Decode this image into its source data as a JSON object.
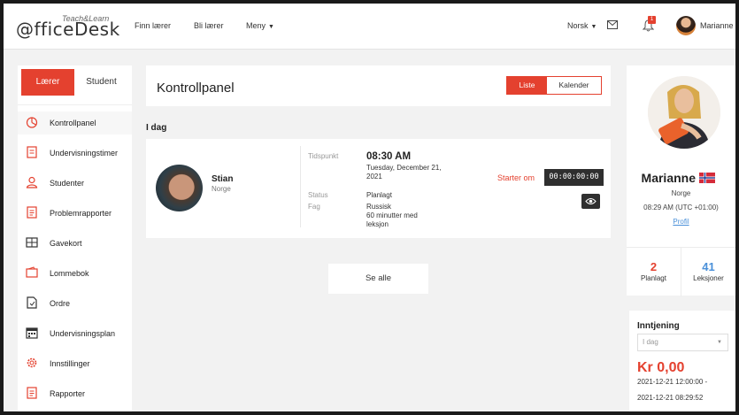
{
  "header": {
    "logo_text": "@fficeDesk",
    "logo_sup": "Teach&Learn",
    "nav": [
      {
        "label": "Finn lærer"
      },
      {
        "label": "Bli lærer"
      },
      {
        "label": "Meny"
      }
    ],
    "language": "Norsk",
    "notification_count": "1",
    "user_name": "Marianne"
  },
  "sidebar": {
    "role_active": "Lærer",
    "role_inactive": "Student",
    "items": [
      {
        "label": "Kontrollpanel",
        "icon": "pie-chart-icon"
      },
      {
        "label": "Undervisningstimer",
        "icon": "document-icon"
      },
      {
        "label": "Studenter",
        "icon": "user-icon"
      },
      {
        "label": "Problemrapporter",
        "icon": "report-icon"
      },
      {
        "label": "Gavekort",
        "icon": "gift-card-icon"
      },
      {
        "label": "Lommebok",
        "icon": "wallet-icon"
      },
      {
        "label": "Ordre",
        "icon": "order-icon"
      },
      {
        "label": "Undervisningsplan",
        "icon": "calendar-icon"
      },
      {
        "label": "Innstillinger",
        "icon": "gear-icon"
      },
      {
        "label": "Rapporter",
        "icon": "report-icon"
      }
    ]
  },
  "main": {
    "title": "Kontrollpanel",
    "view_active": "Liste",
    "view_inactive": "Kalender",
    "today_label": "I dag",
    "lesson": {
      "student_name": "Stian",
      "student_country": "Norge",
      "time_label": "Tidspunkt",
      "time_value": "08:30 AM",
      "date_value": "Tuesday, December 21, 2021",
      "status_label": "Status",
      "status_value": "Planlagt",
      "subject_label": "Fag",
      "subject_value": "Russisk",
      "duration_value": "60 minutter med leksjon",
      "starts_label": "Starter om",
      "countdown": "00:00:00:00"
    },
    "see_all": "Se alle"
  },
  "profile": {
    "name": "Marianne",
    "country": "Norge",
    "local_time": "08:29 AM (UTC +01:00)",
    "link": "Profil"
  },
  "stats": {
    "planned_count": "2",
    "planned_label": "Planlagt",
    "lessons_count": "41",
    "lessons_label": "Leksjoner"
  },
  "earnings": {
    "title": "Inntjening",
    "period": "I dag",
    "amount": "Kr 0,00",
    "range_start": "2021-12-21 12:00:00 -",
    "range_end": "2021-12-21 08:29:52"
  },
  "colors": {
    "accent": "#e4412f",
    "link": "#4a90d9",
    "dark_button": "#2f2f2f",
    "planned": "#e4412f",
    "lessons": "#4a90d9"
  }
}
